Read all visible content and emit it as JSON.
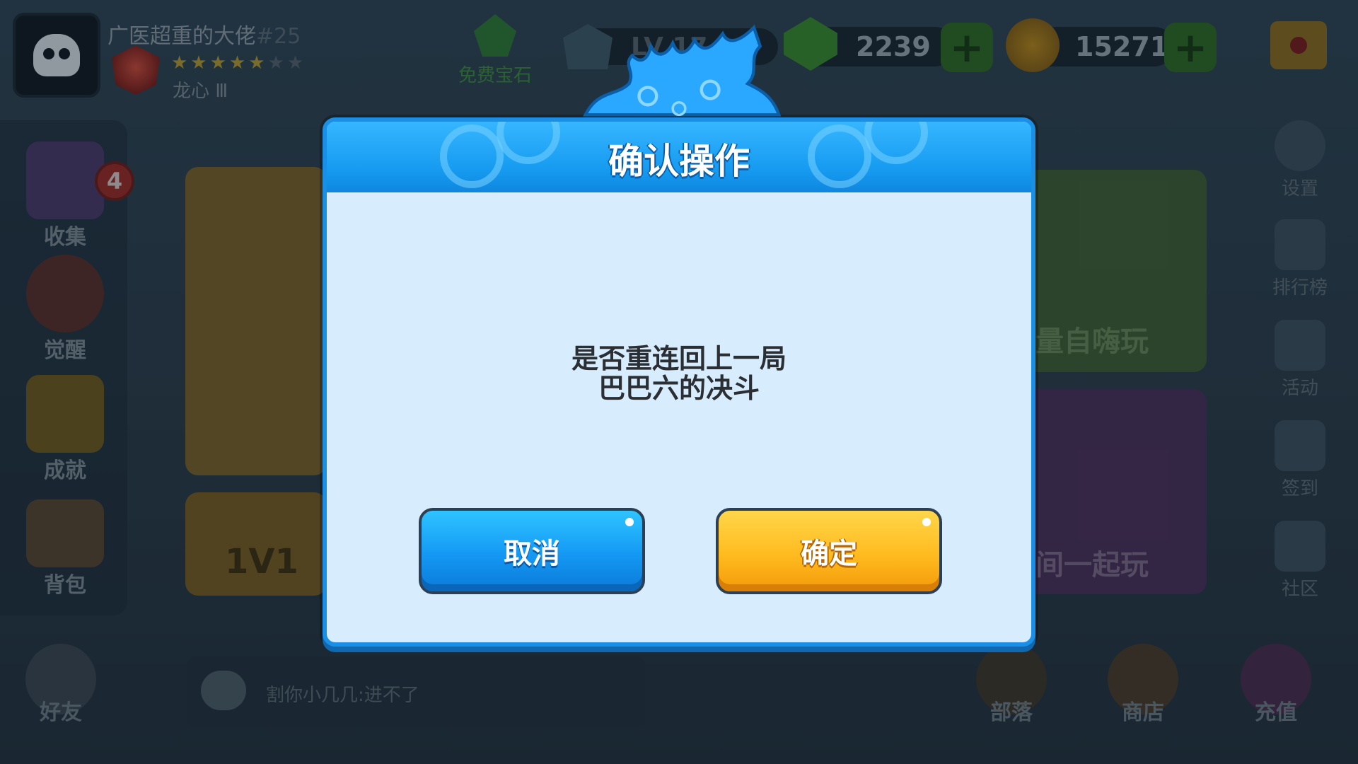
{
  "player": {
    "name": "广医超重的大佬",
    "tag": "#25",
    "rank_name": "龙心 Ⅲ",
    "stars_filled": 5,
    "stars_total": 7
  },
  "topbar": {
    "free_gem_label": "免费宝石",
    "level_label": "LV 17",
    "gems": "2239",
    "coins": "15271"
  },
  "left_menu": [
    {
      "label": "收集",
      "badge": "4"
    },
    {
      "label": "觉醒"
    },
    {
      "label": "成就"
    },
    {
      "label": "背包"
    }
  ],
  "right_menu": [
    {
      "label": "设置"
    },
    {
      "label": "排行榜"
    },
    {
      "label": "活动"
    },
    {
      "label": "签到"
    },
    {
      "label": "社区"
    }
  ],
  "cards": {
    "left_small_label": "1V1",
    "right_top_label": "量自嗨玩",
    "right_bottom_label": "间一起玩"
  },
  "chat": {
    "text": "割你小几几:进不了"
  },
  "bottom_menu": [
    {
      "label": "好友"
    },
    {
      "label": "部落"
    },
    {
      "label": "商店"
    },
    {
      "label": "充值"
    }
  ],
  "dialog": {
    "title": "确认操作",
    "message_line1": "是否重连回上一局",
    "message_line2": "巴巴六的决斗",
    "cancel_label": "取消",
    "confirm_label": "确定"
  },
  "colors": {
    "dialog_blue": "#159af0",
    "confirm_yellow": "#ffbb1f",
    "cancel_blue": "#1498f4"
  }
}
